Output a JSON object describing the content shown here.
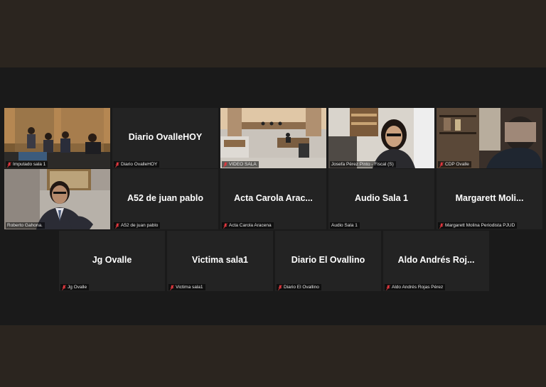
{
  "meeting": {
    "colors": {
      "active_border": "#d7e357",
      "muted_icon": "#e0383e",
      "tile_bg": "#232323"
    },
    "tiles": [
      {
        "id": "imputado",
        "label": "Imputado sala 1",
        "muted": true,
        "video": true
      },
      {
        "id": "diario-ovallehoy",
        "big": "Diario OvalleHOY",
        "label": "Diario OvalleHOY",
        "muted": true,
        "video": false
      },
      {
        "id": "video-sala",
        "label": "VIDEO SALA",
        "muted": true,
        "video": true
      },
      {
        "id": "josefa",
        "label": "Josefa Pérez Pinto - Fiscal (S)",
        "muted": false,
        "video": true
      },
      {
        "id": "cdp-ovalle",
        "label": "CDP Ovalle",
        "muted": true,
        "video": true
      },
      {
        "id": "roberto",
        "label": "Roberto Gahona.",
        "muted": false,
        "video": true,
        "active_speaker": true
      },
      {
        "id": "a52",
        "big": "A52 de juan pablo",
        "label": "A52 de juan pablo",
        "muted": true,
        "video": false
      },
      {
        "id": "acta-carola",
        "big": "Acta  Carola  Arac...",
        "label": "Acta Carola Aracena",
        "muted": true,
        "video": false
      },
      {
        "id": "audio-sala",
        "big": "Audio Sala 1",
        "label": "Audio Sala 1",
        "muted": false,
        "video": false
      },
      {
        "id": "margarett",
        "big": "Margarett  Moli...",
        "label": "Margarett Molina Periodista PJUD",
        "muted": true,
        "video": false
      },
      {
        "id": "jg-ovalle",
        "big": "Jg Ovalle",
        "label": "Jg Ovalle",
        "muted": true,
        "video": false
      },
      {
        "id": "victima",
        "big": "Victima sala1",
        "label": "Victima sala1",
        "muted": true,
        "video": false
      },
      {
        "id": "diario-ovallino",
        "big": "Diario El Ovallino",
        "label": "Diario El Ovallino",
        "muted": true,
        "video": false
      },
      {
        "id": "aldo",
        "big": "Aldo  Andrés  Roj...",
        "label": "Aldo Andrés Rojas Pérez",
        "muted": true,
        "video": false
      }
    ]
  }
}
